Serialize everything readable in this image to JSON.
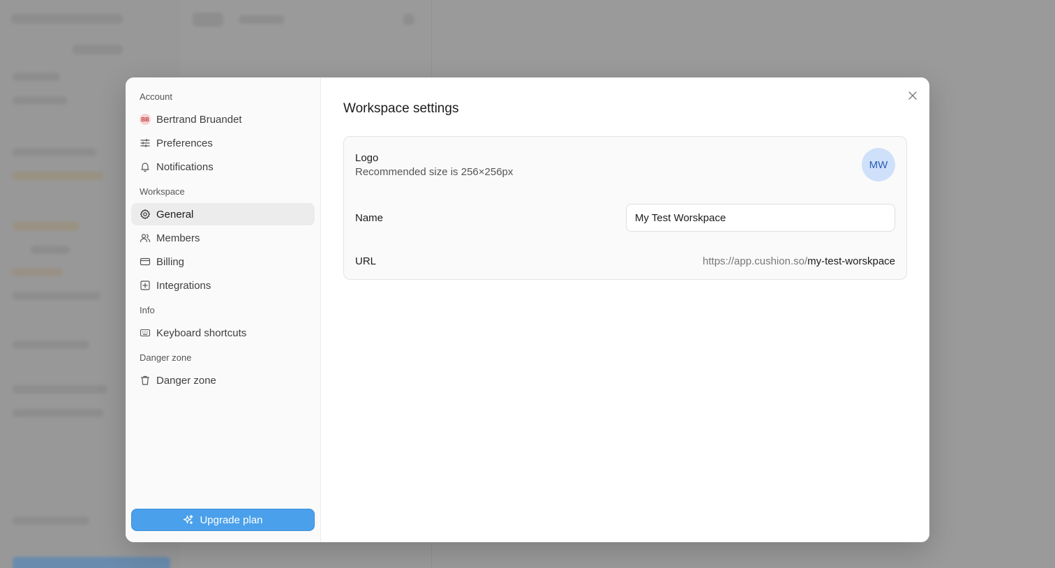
{
  "nav": {
    "sections": {
      "account": "Account",
      "workspace": "Workspace",
      "info": "Info",
      "danger": "Danger zone"
    },
    "items": {
      "user": {
        "label": "Bertrand Bruandet",
        "initials": "BB"
      },
      "preferences": "Preferences",
      "notifications": "Notifications",
      "general": "General",
      "members": "Members",
      "billing": "Billing",
      "integrations": "Integrations",
      "shortcuts": "Keyboard shortcuts",
      "danger_zone": "Danger zone"
    },
    "upgrade_label": "Upgrade plan"
  },
  "content": {
    "title": "Workspace settings",
    "logo": {
      "label": "Logo",
      "hint": "Recommended size is 256×256px",
      "initials": "MW"
    },
    "name": {
      "label": "Name",
      "value": "My Test Worskpace"
    },
    "url": {
      "label": "URL",
      "prefix": "https://app.cushion.so/",
      "slug": "my-test-worskpace"
    }
  },
  "colors": {
    "accent": "#4aa0ea",
    "active_nav_bg": "#ececec",
    "avatar_bg": "#cfe0fb",
    "avatar_text": "#2b5fb5"
  }
}
